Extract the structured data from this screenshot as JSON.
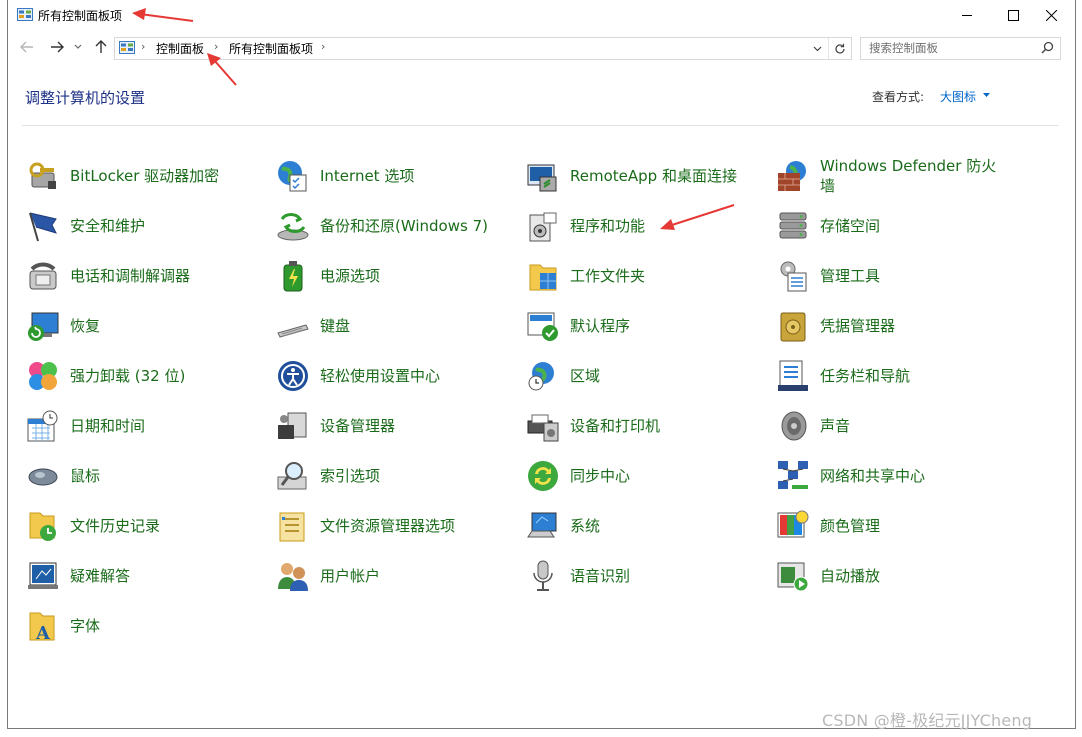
{
  "window": {
    "title": "所有控制面板项",
    "controls": {
      "minimize_icon": "minimize-icon",
      "maximize_icon": "maximize-icon",
      "close_icon": "close-icon"
    }
  },
  "addressbar": {
    "crumbs": [
      "控制面板",
      "所有控制面板项"
    ]
  },
  "search": {
    "placeholder": "搜索控制面板"
  },
  "header": {
    "title": "调整计算机的设置",
    "viewby_label": "查看方式:",
    "viewby_value": "大图标"
  },
  "items": [
    [
      "BitLocker 驱动器加密",
      "Internet 选项",
      "RemoteApp 和桌面连接",
      "Windows Defender 防火墙"
    ],
    [
      "安全和维护",
      "备份和还原(Windows 7)",
      "程序和功能",
      "存储空间"
    ],
    [
      "电话和调制解调器",
      "电源选项",
      "工作文件夹",
      "管理工具"
    ],
    [
      "恢复",
      "键盘",
      "默认程序",
      "凭据管理器"
    ],
    [
      "强力卸载 (32 位)",
      "轻松使用设置中心",
      "区域",
      "任务栏和导航"
    ],
    [
      "日期和时间",
      "设备管理器",
      "设备和打印机",
      "声音"
    ],
    [
      "鼠标",
      "索引选项",
      "同步中心",
      "网络和共享中心"
    ],
    [
      "文件历史记录",
      "文件资源管理器选项",
      "系统",
      "颜色管理"
    ],
    [
      "疑难解答",
      "用户帐户",
      "语音识别",
      "自动播放"
    ],
    [
      "字体"
    ]
  ],
  "watermark": "CSDN @橙-极纪元JJYCheng",
  "colors": {
    "link_green": "#1a6b1a",
    "title_blue": "#1e3287",
    "accent_blue": "#0066cc",
    "arrow_red": "#e53935"
  }
}
